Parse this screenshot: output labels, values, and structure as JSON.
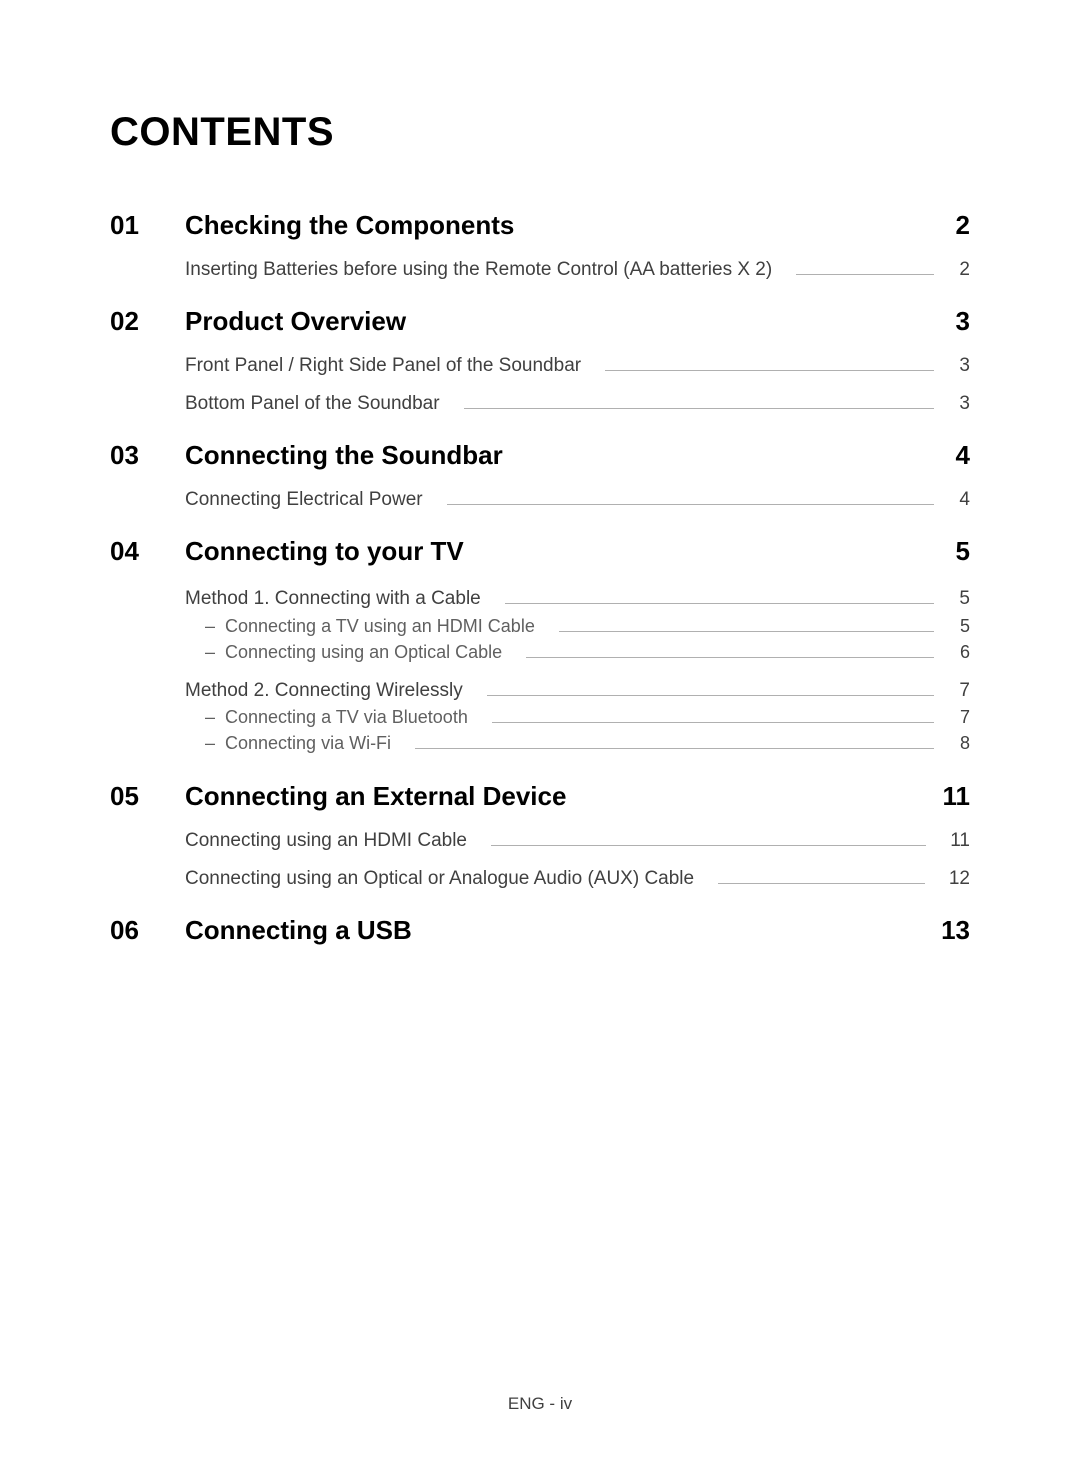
{
  "title": "CONTENTS",
  "footer": "ENG - iv",
  "sections": [
    {
      "num": "01",
      "title": "Checking the Components",
      "page": "2",
      "items": [
        {
          "label": "Inserting Batteries before using the Remote Control (AA batteries X 2)",
          "page": "2"
        }
      ]
    },
    {
      "num": "02",
      "title": "Product Overview",
      "page": "3",
      "items": [
        {
          "label": "Front Panel / Right Side Panel of the Soundbar",
          "page": "3"
        },
        {
          "label": "Bottom Panel of the Soundbar",
          "page": "3"
        }
      ]
    },
    {
      "num": "03",
      "title": "Connecting the Soundbar",
      "page": "4",
      "items": [
        {
          "label": "Connecting Electrical Power",
          "page": "4"
        }
      ]
    },
    {
      "num": "04",
      "title": "Connecting to your TV",
      "page": "5",
      "groups": [
        {
          "label": "Method 1. Connecting with a Cable",
          "page": "5",
          "subs": [
            {
              "label": "Connecting a TV using an HDMI Cable",
              "page": "5"
            },
            {
              "label": "Connecting using an Optical Cable",
              "page": "6"
            }
          ]
        },
        {
          "label": "Method 2. Connecting Wirelessly",
          "page": "7",
          "subs": [
            {
              "label": "Connecting a TV via Bluetooth",
              "page": "7"
            },
            {
              "label": "Connecting via Wi-Fi",
              "page": "8"
            }
          ]
        }
      ]
    },
    {
      "num": "05",
      "title": "Connecting an External Device",
      "page": "11",
      "items": [
        {
          "label": "Connecting using an HDMI Cable",
          "page": "11"
        },
        {
          "label": "Connecting using an Optical or Analogue Audio (AUX) Cable",
          "page": "12"
        }
      ]
    },
    {
      "num": "06",
      "title": "Connecting a USB",
      "page": "13"
    }
  ]
}
